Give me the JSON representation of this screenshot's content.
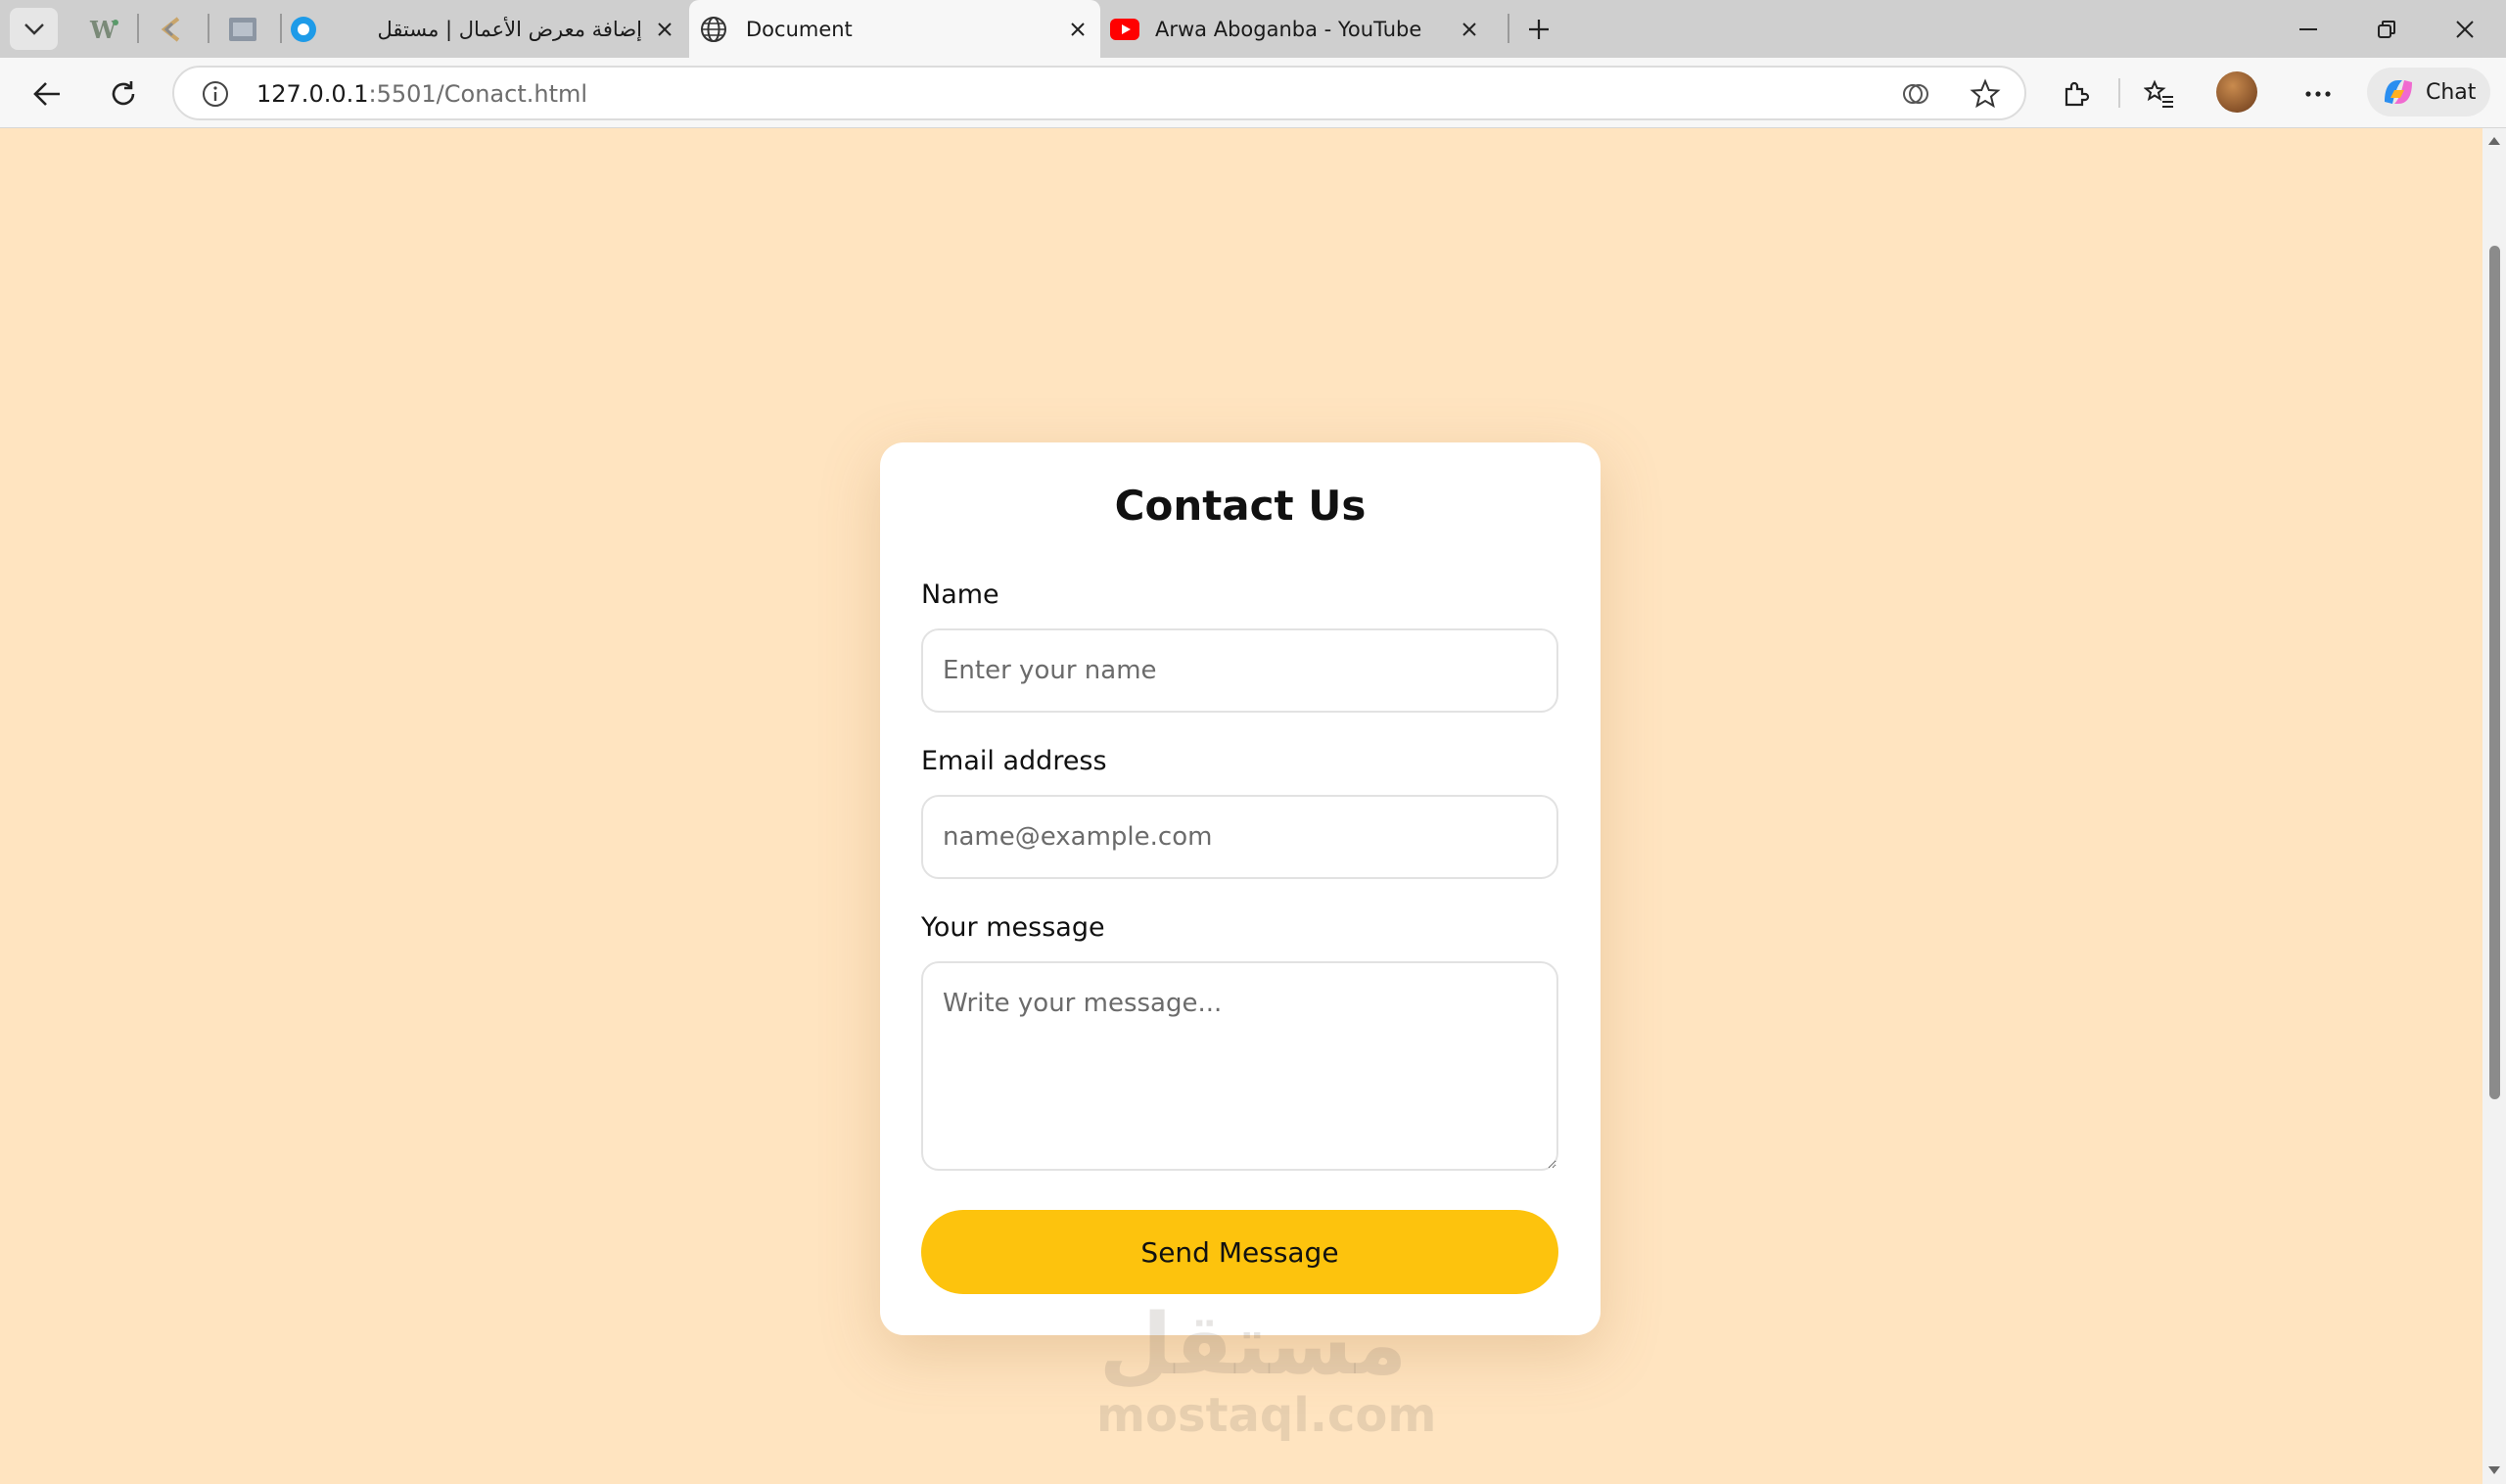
{
  "browser": {
    "tabs": [
      {
        "title": "إضافة معرض الأعمال | مستقل",
        "active": false
      },
      {
        "title": "Document",
        "active": true
      },
      {
        "title": "Arwa Aboganba - YouTube",
        "active": false
      }
    ],
    "address_bar": {
      "url_host": "127.0.0.1",
      "url_rest": ":5501/Conact.html"
    },
    "chat_label": "Chat"
  },
  "page": {
    "background": "#ffe4c0",
    "form": {
      "title": "Contact Us",
      "name_label": "Name",
      "name_placeholder": "Enter your name",
      "name_value": "",
      "email_label": "Email address",
      "email_placeholder": "name@example.com",
      "email_value": "",
      "message_label": "Your message",
      "message_placeholder": "Write your message...",
      "message_value": "",
      "submit_label": "Send Message",
      "submit_color": "#fdc30d"
    },
    "watermark": {
      "arabic": "مستقل",
      "latin": "mostaql.com"
    }
  }
}
